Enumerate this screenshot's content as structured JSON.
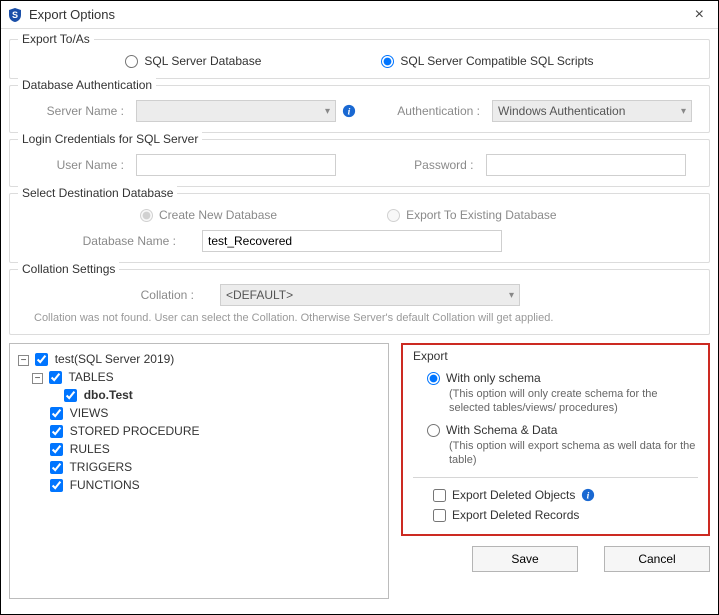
{
  "window": {
    "title": "Export Options",
    "close_icon": "×"
  },
  "export_to": {
    "legend": "Export To/As",
    "opt_db": "SQL Server Database",
    "opt_scripts": "SQL Server Compatible SQL Scripts",
    "selected": "scripts"
  },
  "auth_section": {
    "legend": "Database Authentication",
    "server_label": "Server Name :",
    "server_value": "",
    "auth_label": "Authentication :",
    "auth_value": "Windows Authentication"
  },
  "login_section": {
    "legend": "Login Credentials for SQL Server",
    "user_label": "User Name :",
    "user_value": "",
    "pass_label": "Password :",
    "pass_value": ""
  },
  "dest_section": {
    "legend": "Select Destination Database",
    "opt_create": "Create New Database",
    "opt_existing": "Export To Existing Database",
    "dbname_label": "Database Name :",
    "dbname_value": "test_Recovered"
  },
  "collation_section": {
    "legend": "Collation Settings",
    "collation_label": "Collation :",
    "collation_value": "<DEFAULT>",
    "note": "Collation was not found. User can select the Collation. Otherwise Server's default Collation will get applied."
  },
  "tree": {
    "root": "test(SQL Server 2019)",
    "nodes": {
      "tables": "TABLES",
      "dbo_test": "dbo.Test",
      "views": "VIEWS",
      "sp": "STORED PROCEDURE",
      "rules": "RULES",
      "triggers": "TRIGGERS",
      "functions": "FUNCTIONS"
    }
  },
  "export_panel": {
    "legend": "Export",
    "schema_only": "With only schema",
    "schema_only_desc": "(This option will only create schema for the  selected tables/views/ procedures)",
    "schema_data": "With Schema & Data",
    "schema_data_desc": "(This option will export schema as well data for the table)",
    "del_objects": "Export Deleted Objects",
    "del_records": "Export Deleted Records"
  },
  "buttons": {
    "save": "Save",
    "cancel": "Cancel"
  }
}
